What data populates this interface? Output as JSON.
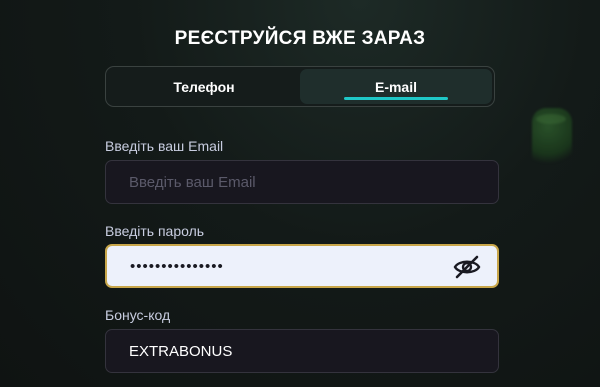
{
  "title": "РЕЄСТРУЙСЯ ВЖЕ ЗАРАЗ",
  "tabs": [
    {
      "label": "Телефон",
      "active": false
    },
    {
      "label": "E-mail",
      "active": true
    }
  ],
  "email": {
    "label": "Введіть ваш Email",
    "placeholder": "Введіть ваш Email",
    "value": ""
  },
  "password": {
    "label": "Введіть пароль",
    "value": "•••••••••••••••",
    "visibility_icon": "eye-off-icon"
  },
  "bonus": {
    "label": "Бонус-код",
    "value": "EXTRABONUS"
  },
  "colors": {
    "accent": "#1fc7c7",
    "focus_border": "#c8a64a",
    "field_bg": "#18171f",
    "focused_field_bg": "#edf1fb"
  }
}
